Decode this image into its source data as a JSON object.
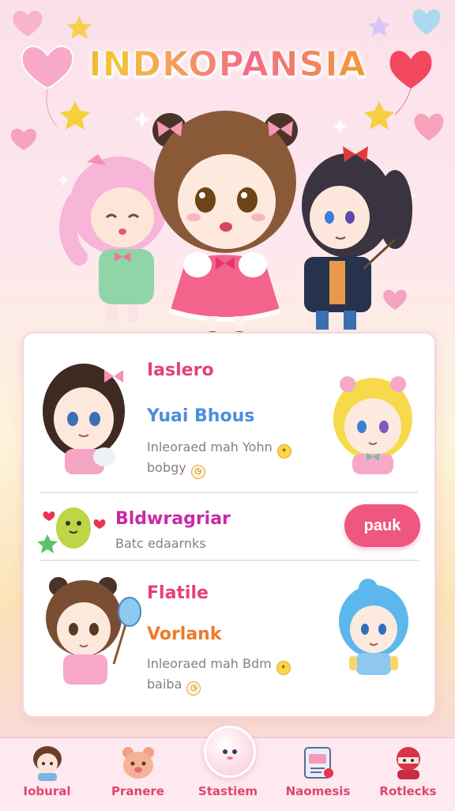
{
  "game": {
    "title": "INDKOPANSIA"
  },
  "colors": {
    "accent": "#ef5680",
    "title_pink": "#e3417c",
    "title_blue": "#4a90d9",
    "title_orange": "#ee7a2a",
    "nav_bg": "#fde9ef"
  },
  "panel": {
    "cards": [
      {
        "name": "Iaslero",
        "subtitle": "Yuai Bhous",
        "desc_line1": "Inleoraed mah Yohn",
        "desc_line2": "bobgy",
        "left_char_icon": "brown-hair-girl-icon",
        "right_char_icon": "blonde-girl-icon"
      },
      {
        "name": "Bldwragriar",
        "desc": "Batc edaarnks",
        "button_label": "pauk",
        "mascot_icon": "green-blob-mascot-icon"
      },
      {
        "name": "Flatile",
        "subtitle": "Vorlank",
        "desc_line1": "Inleoraed mah Bdm",
        "desc_line2": "baiba",
        "left_char_icon": "wand-girl-icon",
        "right_char_icon": "blue-hair-girl-icon"
      }
    ]
  },
  "nav": {
    "items": [
      {
        "label": "Iobural",
        "icon": "boy-avatar-icon"
      },
      {
        "label": "Pranere",
        "icon": "bear-icon"
      },
      {
        "label": "Stastiem",
        "icon": "orb-icon"
      },
      {
        "label": "Naomesis",
        "icon": "notebook-icon"
      },
      {
        "label": "Rotlecks",
        "icon": "ninja-icon"
      }
    ]
  }
}
